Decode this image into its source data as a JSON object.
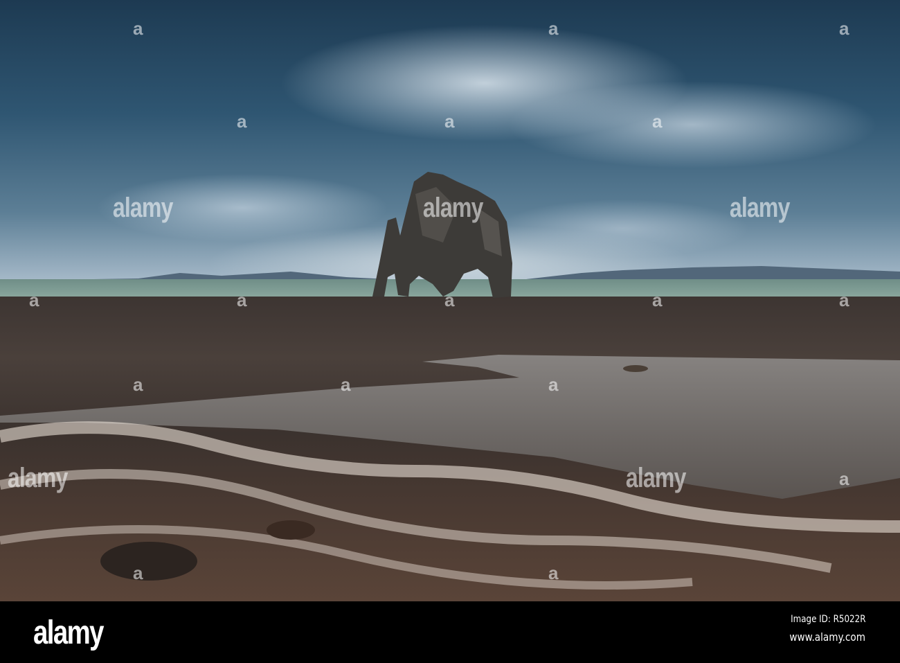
{
  "watermark": {
    "logo_text": "alamy",
    "small_mark": "a"
  },
  "footer": {
    "logo": "alamy",
    "image_id": "Image ID: R5022R",
    "website": "www.alamy.com"
  }
}
